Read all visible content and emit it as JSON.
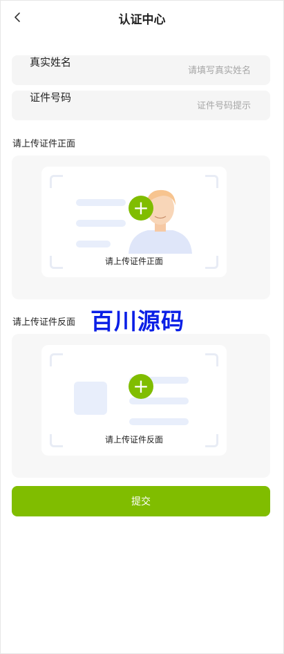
{
  "header": {
    "title": "认证中心",
    "back_icon": "chevron-left-icon"
  },
  "form": {
    "name_field": {
      "label": "真实姓名",
      "placeholder": "请填写真实姓名",
      "value": ""
    },
    "id_field": {
      "label": "证件号码",
      "placeholder": "证件号码提示",
      "value": ""
    }
  },
  "front_section": {
    "label": "请上传证件正面",
    "caption": "请上传证件正面",
    "plus_icon": "plus-icon"
  },
  "back_section": {
    "label": "请上传证件反面",
    "caption": "请上传证件反面",
    "plus_icon": "plus-icon"
  },
  "watermark": "百川源码",
  "submit_label": "提交",
  "colors": {
    "accent": "#80bd00",
    "field_bg": "#f5f5f5",
    "placeholder_bar": "#e8eefb",
    "watermark": "#0a1fe6"
  }
}
